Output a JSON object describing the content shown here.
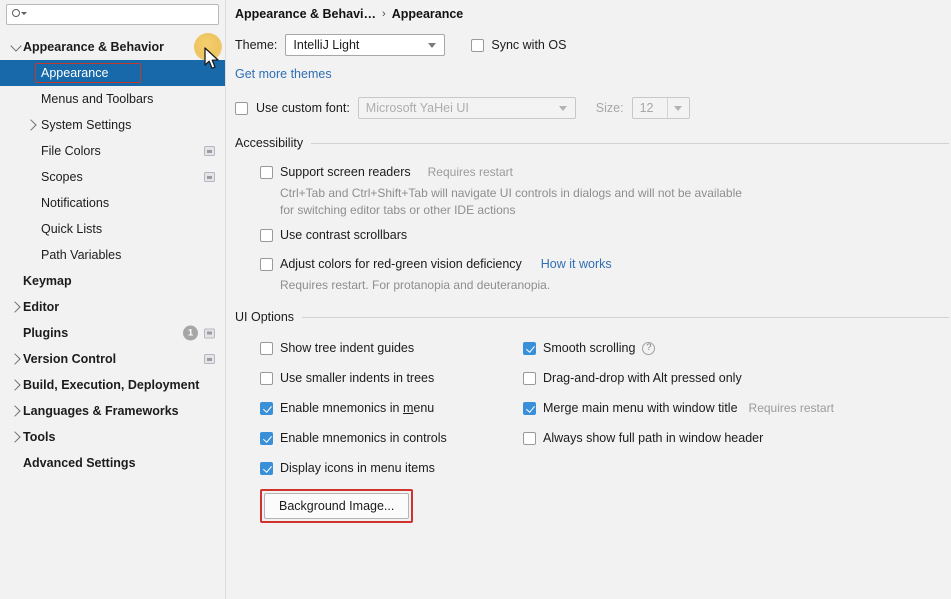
{
  "window": {
    "accent_blue": "#1769aa",
    "highlight_red": "#c0392b",
    "checkbox_blue": "#3a90d8"
  },
  "sidebar": {
    "search": {
      "value": "",
      "placeholder": "",
      "icon": "search-icon"
    },
    "items": [
      {
        "label": "Appearance & Behavior",
        "level": 0,
        "twisty": "chevron-down",
        "bold": true,
        "selected": false
      },
      {
        "label": "Appearance",
        "level": 1,
        "twisty": "none",
        "bold": false,
        "selected": true
      },
      {
        "label": "Menus and Toolbars",
        "level": 1,
        "twisty": "none",
        "bold": false,
        "selected": false
      },
      {
        "label": "System Settings",
        "level": 1,
        "twisty": "chevron-right",
        "bold": false,
        "selected": false
      },
      {
        "label": "File Colors",
        "level": 1,
        "twisty": "none",
        "bold": false,
        "selected": false,
        "trailing_icon": "copy-icon"
      },
      {
        "label": "Scopes",
        "level": 1,
        "twisty": "none",
        "bold": false,
        "selected": false,
        "trailing_icon": "copy-icon"
      },
      {
        "label": "Notifications",
        "level": 1,
        "twisty": "none",
        "bold": false,
        "selected": false
      },
      {
        "label": "Quick Lists",
        "level": 1,
        "twisty": "none",
        "bold": false,
        "selected": false
      },
      {
        "label": "Path Variables",
        "level": 1,
        "twisty": "none",
        "bold": false,
        "selected": false
      },
      {
        "label": "Keymap",
        "level": 0,
        "twisty": "none",
        "bold": true,
        "selected": false
      },
      {
        "label": "Editor",
        "level": 0,
        "twisty": "chevron-right",
        "bold": true,
        "selected": false
      },
      {
        "label": "Plugins",
        "level": 0,
        "twisty": "none",
        "bold": true,
        "selected": false,
        "badge": "1",
        "trailing_icon": "copy-icon"
      },
      {
        "label": "Version Control",
        "level": 0,
        "twisty": "chevron-right",
        "bold": true,
        "selected": false,
        "trailing_icon": "copy-icon"
      },
      {
        "label": "Build, Execution, Deployment",
        "level": 0,
        "twisty": "chevron-right",
        "bold": true,
        "selected": false
      },
      {
        "label": "Languages & Frameworks",
        "level": 0,
        "twisty": "chevron-right",
        "bold": true,
        "selected": false
      },
      {
        "label": "Tools",
        "level": 0,
        "twisty": "chevron-right",
        "bold": true,
        "selected": false
      },
      {
        "label": "Advanced Settings",
        "level": 0,
        "twisty": "none",
        "bold": true,
        "selected": false
      }
    ]
  },
  "main": {
    "breadcrumb": {
      "parent": "Appearance & Behavi…",
      "separator": "›",
      "current": "Appearance"
    },
    "theme": {
      "label": "Theme:",
      "value": "IntelliJ Light",
      "sync_with_os_label": "Sync with OS",
      "sync_with_os_checked": false,
      "get_more_themes_link": "Get more themes"
    },
    "font": {
      "use_custom_font_label": "Use custom font:",
      "use_custom_font_checked": false,
      "font_value": "Microsoft YaHei UI",
      "size_label": "Size:",
      "size_value": "12"
    },
    "accessibility": {
      "title": "Accessibility",
      "options": [
        {
          "label": "Support screen readers",
          "checked": false,
          "note": "Requires restart",
          "description": "Ctrl+Tab and Ctrl+Shift+Tab will navigate UI controls in dialogs and will not be available for switching editor tabs or other IDE actions"
        },
        {
          "label": "Use contrast scrollbars",
          "checked": false,
          "note": "",
          "description": ""
        },
        {
          "label": "Adjust colors for red-green vision deficiency",
          "checked": false,
          "link": "How it works",
          "description": "Requires restart. For protanopia and deuteranopia."
        }
      ]
    },
    "ui_options": {
      "title": "UI Options",
      "left_column": [
        {
          "label": "Show tree indent guides",
          "checked": false
        },
        {
          "label": "Use smaller indents in trees",
          "checked": false
        },
        {
          "label": "Enable mnemonics in menu",
          "checked": true,
          "mnemonic": "m"
        },
        {
          "label": "Enable mnemonics in controls",
          "checked": true
        },
        {
          "label": "Display icons in menu items",
          "checked": true
        }
      ],
      "right_column": [
        {
          "label": "Smooth scrolling",
          "checked": true,
          "help": "?"
        },
        {
          "label": "Drag-and-drop with Alt pressed only",
          "checked": false
        },
        {
          "label": "Merge main menu with window title",
          "checked": true,
          "note": "Requires restart"
        },
        {
          "label": "Always show full path in window header",
          "checked": false
        }
      ],
      "background_image_button": "Background Image..."
    }
  }
}
